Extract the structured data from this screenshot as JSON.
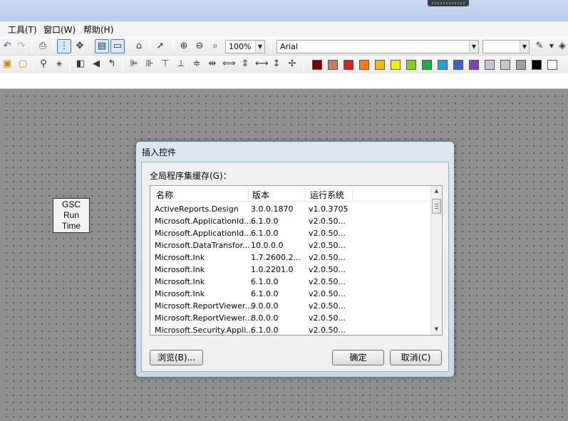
{
  "menu": {
    "tools": "工具(T)",
    "window": "窗口(W)",
    "help": "帮助(H)"
  },
  "toolbar": {
    "zoom_value": "100%",
    "font_name": "Arial",
    "font_size": "",
    "colors": [
      "#800000",
      "#c08060",
      "#e02020",
      "#ff8000",
      "#f0c000",
      "#f0f000",
      "#80d020",
      "#20b040",
      "#20a0e0",
      "#4060d0",
      "#8040c0",
      "#d0c0e0",
      "#c8c8c8",
      "#a0a0a0",
      "#000000",
      "#ffffff"
    ]
  },
  "canvas": {
    "control_text_1": "GSC",
    "control_text_2": "Run",
    "control_text_3": "Time"
  },
  "dialog": {
    "title": "插入控件",
    "group_label": "全局程序集缓存(G)：",
    "columns": {
      "name": "名称",
      "version": "版本",
      "runtime": "运行系统"
    },
    "rows": [
      {
        "name": "ActiveReports.Design",
        "version": "3.0.0.1870",
        "runtime": "v1.0.3705"
      },
      {
        "name": "Microsoft.ApplicationId....",
        "version": "6.1.0.0",
        "runtime": "v2.0.50..."
      },
      {
        "name": "Microsoft.ApplicationId....",
        "version": "6.1.0.0",
        "runtime": "v2.0.50..."
      },
      {
        "name": "Microsoft.DataTransfor...",
        "version": "10.0.0.0",
        "runtime": "v2.0.50..."
      },
      {
        "name": "Microsoft.Ink",
        "version": "1.7.2600.2...",
        "runtime": "v2.0.50..."
      },
      {
        "name": "Microsoft.Ink",
        "version": "1.0.2201.0",
        "runtime": "v2.0.50..."
      },
      {
        "name": "Microsoft.Ink",
        "version": "6.1.0.0",
        "runtime": "v2.0.50..."
      },
      {
        "name": "Microsoft.Ink",
        "version": "6.1.0.0",
        "runtime": "v2.0.50..."
      },
      {
        "name": "Microsoft.ReportViewer....",
        "version": "9.0.0.0",
        "runtime": "v2.0.50..."
      },
      {
        "name": "Microsoft.ReportViewer...",
        "version": "8.0.0.0",
        "runtime": "v2.0.50..."
      },
      {
        "name": "Microsoft.Security.Appli...",
        "version": "6.1.0.0",
        "runtime": "v2.0.50..."
      }
    ],
    "browse_label": "浏览(B)...",
    "ok_label": "确定",
    "cancel_label": "取消(C)"
  }
}
